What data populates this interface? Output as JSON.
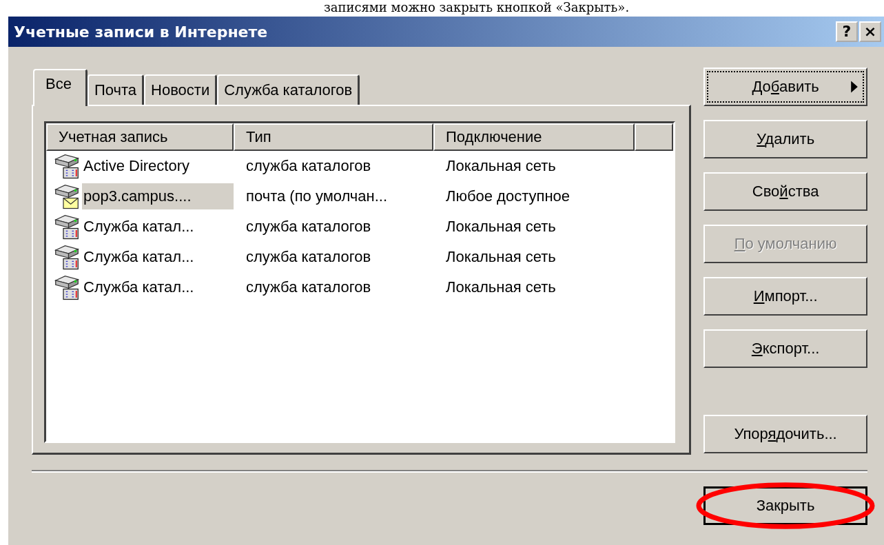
{
  "document_text": "записями можно закрыть кнопкой «Закрыть».",
  "window": {
    "title": "Учетные записи в Интернете",
    "title_buttons": [
      "?",
      "×"
    ]
  },
  "tabs": [
    {
      "label": "Все",
      "selected": true
    },
    {
      "label": "Почта",
      "selected": false
    },
    {
      "label": "Новости",
      "selected": false
    },
    {
      "label": "Служба каталогов",
      "selected": false
    }
  ],
  "table": {
    "columns": [
      "Учетная запись",
      "Тип",
      "Подключение"
    ],
    "rows": [
      {
        "kind": "directory",
        "account": "Active Directory",
        "type": "служба каталогов",
        "connection": "Локальная сеть",
        "selected": false
      },
      {
        "kind": "mail",
        "account": "pop3.campus....",
        "type": "почта (по умолчан...",
        "connection": "Любое доступное",
        "selected": true
      },
      {
        "kind": "directory",
        "account": "Служба катал...",
        "type": "служба каталогов",
        "connection": "Локальная сеть",
        "selected": false
      },
      {
        "kind": "directory",
        "account": "Служба катал...",
        "type": "служба каталогов",
        "connection": "Локальная сеть",
        "selected": false
      },
      {
        "kind": "directory",
        "account": "Служба катал...",
        "type": "служба каталогов",
        "connection": "Локальная сеть",
        "selected": false
      }
    ]
  },
  "buttons": [
    {
      "label_start": "До",
      "access_key": "б",
      "label_rest": "авить",
      "submenu": true,
      "focused": true,
      "disabled": false
    },
    {
      "access_key": "У",
      "label_rest": "далить",
      "submenu": false,
      "focused": false,
      "disabled": false
    },
    {
      "label_start": "Сво",
      "access_key": "й",
      "label_rest": "ства",
      "submenu": false,
      "focused": false,
      "disabled": false
    },
    {
      "access_key": "П",
      "label_rest": "о умолчанию",
      "submenu": false,
      "focused": false,
      "disabled": true
    },
    {
      "access_key": "И",
      "label_rest": "мпорт...",
      "submenu": false,
      "focused": false,
      "disabled": false
    },
    {
      "access_key": "Э",
      "label_rest": "кспорт...",
      "submenu": false,
      "focused": false,
      "disabled": false
    }
  ],
  "sort_button": {
    "label_start": "Упор",
    "access_key": "я",
    "label_rest": "дочить..."
  },
  "close_button": {
    "label": "Закрыть",
    "default": true,
    "circled": true
  }
}
